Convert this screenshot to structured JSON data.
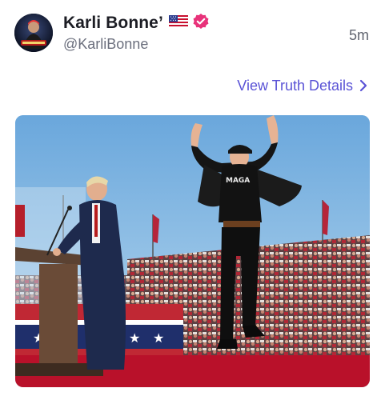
{
  "post": {
    "author": {
      "display_name": "Karli Bonne’",
      "handle": "@KarliBonne",
      "avatar_icon": "profile-avatar",
      "badges": [
        "us-flag-icon",
        "verified-check-icon"
      ]
    },
    "timestamp": "5m",
    "details_link": {
      "label": "View Truth Details",
      "icon": "chevron-right-icon"
    },
    "media": {
      "type": "photo",
      "shirt_text": "MAGA"
    }
  },
  "colors": {
    "accent": "#5a53d6",
    "verified_badge": "#e8327a",
    "name_text": "#1c1d24",
    "secondary_text": "#6b6f7d"
  }
}
